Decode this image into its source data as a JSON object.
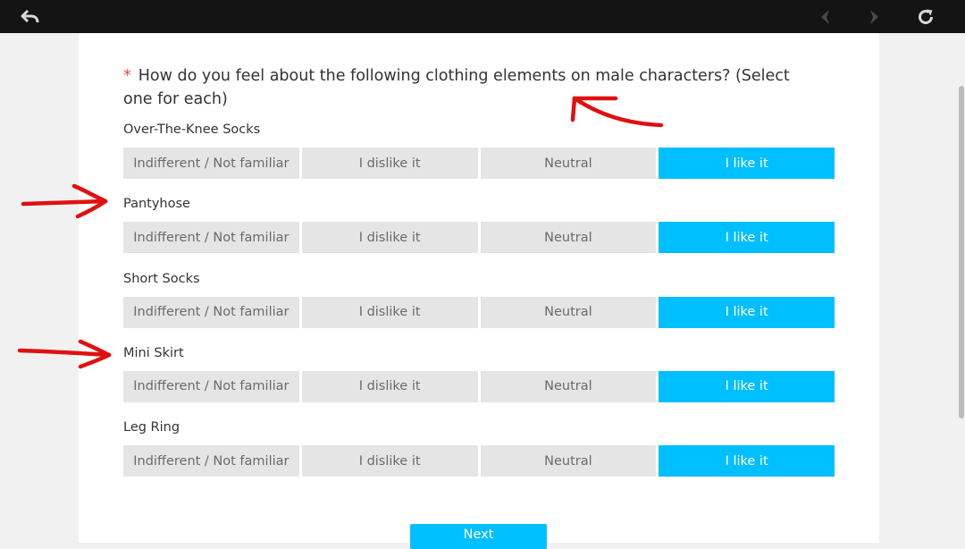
{
  "toolbar": {
    "back_icon": "undo-arrow-icon",
    "prev_icon": "chevron-left-icon",
    "next_icon": "chevron-right-icon",
    "reload_icon": "reload-icon"
  },
  "question": {
    "required_mark": "*",
    "text": "How do you feel about the following clothing elements on male characters?  (Select one for each)"
  },
  "options": [
    "Indifferent / Not familiar",
    "I dislike it",
    "Neutral",
    "I like it"
  ],
  "items": [
    {
      "label": "Over-The-Knee Socks",
      "selected_index": 3
    },
    {
      "label": "Pantyhose",
      "selected_index": 3
    },
    {
      "label": "Short Socks",
      "selected_index": 3
    },
    {
      "label": "Mini Skirt",
      "selected_index": 3
    },
    {
      "label": "Leg Ring",
      "selected_index": 3
    }
  ],
  "next_button": {
    "label": "Next"
  },
  "colors": {
    "accent": "#00bfff",
    "option_bg": "#e5e5e5",
    "required": "#e5484d",
    "annotation": "#e01010"
  }
}
